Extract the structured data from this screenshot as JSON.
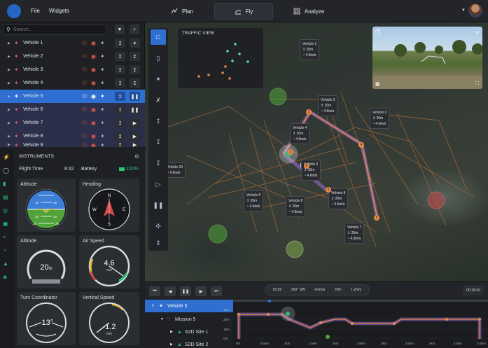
{
  "menu": {
    "file": "File",
    "widgets": "Widgets"
  },
  "nav": {
    "plan": "Plan",
    "fly": "Fly",
    "analyze": "Analyze",
    "active": "Fly"
  },
  "search": {
    "placeholder": "Search...",
    "value": ""
  },
  "vehicles": [
    {
      "name": "Vehicle 1",
      "status_color": "#e05a4f",
      "selected": false,
      "action": "takeoff"
    },
    {
      "name": "Vehicle 2",
      "status_color": "#e05a4f",
      "selected": false,
      "action": "upload"
    },
    {
      "name": "Vehicle 3",
      "status_color": "#e05a4f",
      "selected": false,
      "action": "upload"
    },
    {
      "name": "Vehicle 4",
      "status_color": "#e05a4f",
      "selected": false,
      "action": "upload"
    },
    {
      "name": "Vehicle 5",
      "status_color": "#2fbf71",
      "selected": true,
      "action": "pause"
    },
    {
      "name": "Vehicle 6",
      "status_color": "#e05a4f",
      "selected": false,
      "action": "pause"
    },
    {
      "name": "Vehicle 7",
      "status_color": "#e05a4f",
      "selected": false,
      "action": "play"
    },
    {
      "name": "Vehicle 8",
      "status_color": "#e05a4f",
      "selected": false,
      "action": "play"
    },
    {
      "name": "Vehicle 9",
      "status_color": "#e05a4f",
      "selected": false,
      "action": "play"
    }
  ],
  "instruments": {
    "title": "INSTRUMENTS",
    "flight_time_label": "Flight Time",
    "flight_time": "8:42",
    "battery_label": "Battery",
    "battery": "100%",
    "attitude_label": "Attitude",
    "attitude_marks": [
      "10",
      "10",
      "10",
      "10",
      "20",
      "20"
    ],
    "heading_label": "Heading",
    "heading_marks": {
      "n": "N",
      "e": "E",
      "s": "S",
      "w": "W"
    },
    "altitude_label": "Altitude",
    "altitude_value": "20",
    "altitude_unit": "m",
    "airspeed_label": "Air Speed",
    "airspeed_value": "4.6",
    "airspeed_unit": "m/s",
    "turn_label": "Turn Coordinator",
    "turn_value": "-13°",
    "vspeed_label": "Vertical Speed",
    "vspeed_value": "-1.2",
    "vspeed_unit": "m/s"
  },
  "traffic": {
    "title": "TRAFFIC VIEW"
  },
  "map_labels": [
    {
      "name": "Vehicle 1",
      "alt": "20m",
      "speed": "4.6m/s"
    },
    {
      "name": "Vehicle 2",
      "alt": "20m",
      "speed": "4.6m/s"
    },
    {
      "name": "Vehicle 3",
      "alt": "20m",
      "speed": "4.6m/s"
    },
    {
      "name": "Vehicle 4",
      "alt": "20m",
      "speed": "4.6m/s"
    },
    {
      "name": "Vehicle 5",
      "alt": "20m",
      "speed": "4.6m/s"
    },
    {
      "name": "Vehicle 6",
      "alt": "20m",
      "speed": "4.6m/s"
    },
    {
      "name": "Vehicle 7",
      "alt": "20m",
      "speed": "4.6m/s"
    },
    {
      "name": "Vehicle 8",
      "alt": "20m",
      "speed": "4.6m/s"
    },
    {
      "name": "Vehicle 9",
      "alt": "20m",
      "speed": "4.6m/s"
    },
    {
      "name": "Vehicle 10",
      "alt": "",
      "speed": "4.6m/s"
    }
  ],
  "waypoint_labels": [
    "2",
    "3",
    "4",
    "5",
    "6",
    "8"
  ],
  "playback": {
    "elapsed": "03:02",
    "heading": "250° SW",
    "speed": "4.6m/s",
    "alt": "20m",
    "vspeed": "1.2m/s",
    "remaining": "00:18:42"
  },
  "tree": {
    "vehicle": "Vehicle 5",
    "mission": "Mission 5",
    "site1": "S2D Site 1",
    "site2": "S2D Site 2"
  },
  "profile": {
    "y_ticks": [
      "30m",
      "20m",
      "10m",
      "0m"
    ],
    "x_ticks": [
      "0m",
      "0.5km",
      "1km",
      "1.5km",
      "2km",
      "2.5km",
      "3km",
      "3.5km",
      "4km",
      "4.5km",
      "5.0km"
    ]
  },
  "colors": {
    "accent": "#2e6fd1",
    "ok": "#2fbf71",
    "alert": "#e05a4f",
    "route": "#e8894a",
    "path": "#9b6fd6"
  }
}
